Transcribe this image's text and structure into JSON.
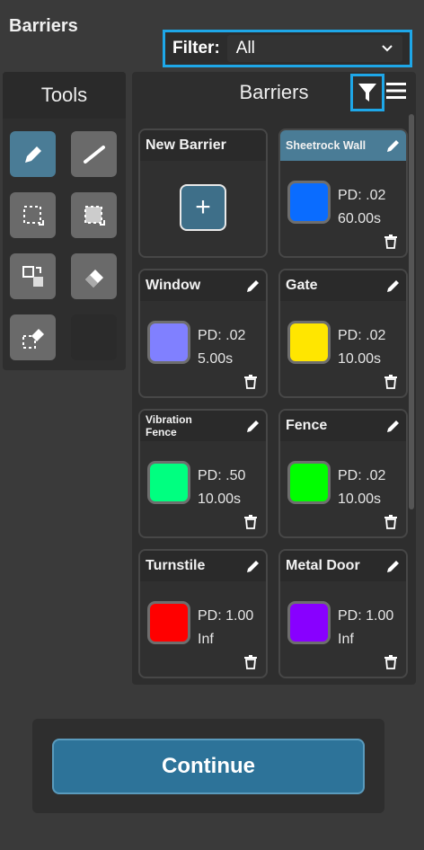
{
  "title": "Barriers",
  "filter": {
    "label": "Filter:",
    "value": "All"
  },
  "tools": {
    "title": "Tools"
  },
  "barriers_panel": {
    "title": "Barriers"
  },
  "new_barrier": {
    "label": "New Barrier",
    "plus": "+"
  },
  "barriers": [
    {
      "name": "Sheetrock Wall",
      "pd": "PD: .02",
      "time": "60.00s",
      "color": "#0a6cff"
    },
    {
      "name": "Window",
      "pd": "PD: .02",
      "time": "5.00s",
      "color": "#8080ff"
    },
    {
      "name": "Gate",
      "pd": "PD: .02",
      "time": "10.00s",
      "color": "#ffe600"
    },
    {
      "name_line1": "Vibration",
      "name_line2": "Fence",
      "pd": "PD: .50",
      "time": "10.00s",
      "color": "#00ff80"
    },
    {
      "name": "Fence",
      "pd": "PD: .02",
      "time": "10.00s",
      "color": "#00ff00"
    },
    {
      "name": "Turnstile",
      "pd": "PD: 1.00",
      "time": "Inf",
      "color": "#ff0000"
    },
    {
      "name": "Metal Door",
      "pd": "PD: 1.00",
      "time": "Inf",
      "color": "#8800ff"
    }
  ],
  "continue_label": "Continue"
}
